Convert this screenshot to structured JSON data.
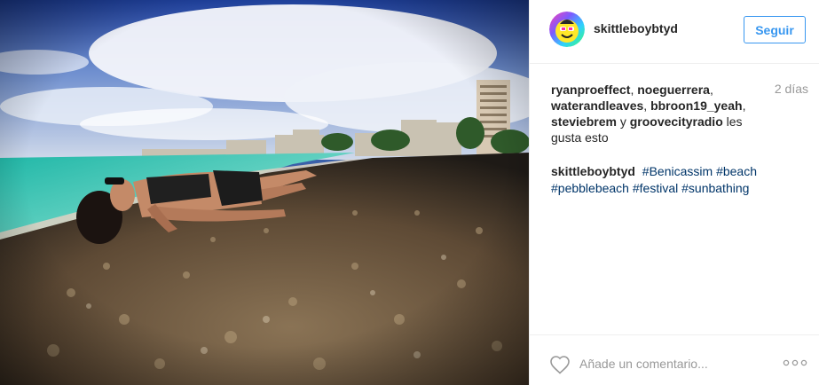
{
  "post": {
    "image_alt": "Beach photo",
    "header": {
      "username": "skittleboybtyd",
      "follow_label": "Seguir",
      "avatar_icon": "smiley-avatar-icon"
    },
    "likes": {
      "users": [
        "ryanproeffect",
        "noeguerrera",
        "waterandleaves",
        "bbroon19_yeah",
        "steviebrem",
        "groovecityradio"
      ],
      "conjunction": "y",
      "suffix": "les gusta esto"
    },
    "time": "2 días",
    "caption": {
      "owner": "skittleboybtyd",
      "hashtags": [
        "#Benicassim",
        "#beach",
        "#pebblebeach",
        "#festival",
        "#sunbathing"
      ]
    },
    "footer": {
      "comment_placeholder": "Añade un comentario...",
      "heart_icon": "heart-outline-icon",
      "more_icon": "more-options-icon"
    }
  },
  "colors": {
    "link_blue": "#3897f0",
    "hashtag": "#003569",
    "muted": "#999999",
    "text": "#262626",
    "divider": "#efefef"
  }
}
